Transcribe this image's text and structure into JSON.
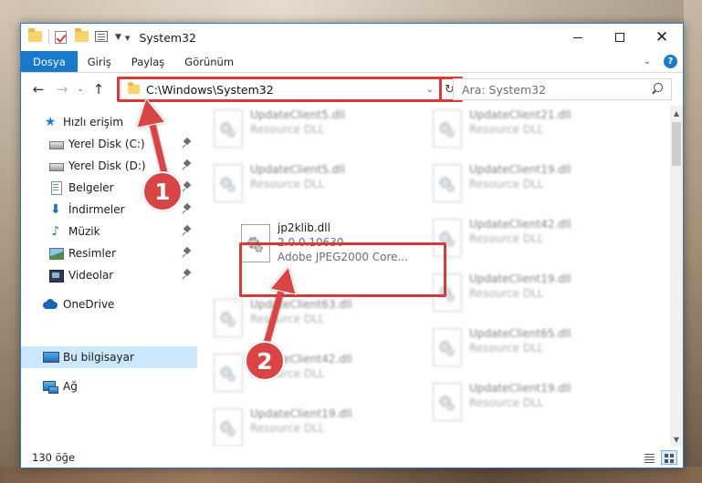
{
  "window": {
    "title": "System32"
  },
  "ribbon": {
    "tabs": [
      "Dosya",
      "Giriş",
      "Paylaş",
      "Görünüm"
    ],
    "active_tab": "Dosya"
  },
  "navbar": {
    "address": "C:\\Windows\\System32",
    "search_placeholder": "Ara: System32"
  },
  "sidebar": {
    "quick_access": "Hızlı erişim",
    "items": [
      {
        "label": "Yerel Disk (C:)"
      },
      {
        "label": "Yerel Disk (D:)"
      },
      {
        "label": "Belgeler"
      },
      {
        "label": "İndirmeler"
      },
      {
        "label": "Müzik"
      },
      {
        "label": "Resimler"
      },
      {
        "label": "Videolar"
      }
    ],
    "onedrive": "OneDrive",
    "this_pc": "Bu bilgisayar",
    "network": "Ağ"
  },
  "files": {
    "left": [
      {
        "name": "UpdateClient5.dll",
        "sub": "Resource DLL"
      },
      {
        "name": "UpdateClient5.dll",
        "sub": "Resource DLL"
      },
      {
        "name": "jp2klib.dll",
        "sub": "2.0.0.10630",
        "sub2": "Adobe JPEG2000 Core..."
      },
      {
        "name": "UpdateClient63.dll",
        "sub": "Resource DLL"
      },
      {
        "name": "UpdateClient42.dll",
        "sub": "Resource DLL"
      },
      {
        "name": "UpdateClient19.dll",
        "sub": "Resource DLL"
      }
    ],
    "right": [
      {
        "name": "UpdateClient21.dll",
        "sub": "Resource DLL"
      },
      {
        "name": "UpdateClient19.dll",
        "sub": "Resource DLL"
      },
      {
        "name": "UpdateClient42.dll",
        "sub": "Resource DLL"
      },
      {
        "name": "UpdateClient19.dll",
        "sub": "Resource DLL"
      },
      {
        "name": "UpdateClient65.dll",
        "sub": "Resource DLL"
      },
      {
        "name": "UpdateClient19.dll",
        "sub": "Resource DLL"
      }
    ]
  },
  "status": {
    "count": "130 öğe"
  },
  "annotations": {
    "step1": "1",
    "step2": "2",
    "highlight_color": "#d83a3a"
  },
  "icons": {
    "quick_access": "star-icon",
    "disk": "disk-icon",
    "documents": "document-icon",
    "downloads": "download-arrow-icon",
    "music": "music-note-icon",
    "pictures": "picture-icon",
    "videos": "film-icon",
    "onedrive": "cloud-icon",
    "this_pc": "monitor-icon",
    "network": "network-icon",
    "file": "dll-gear-file-icon"
  }
}
